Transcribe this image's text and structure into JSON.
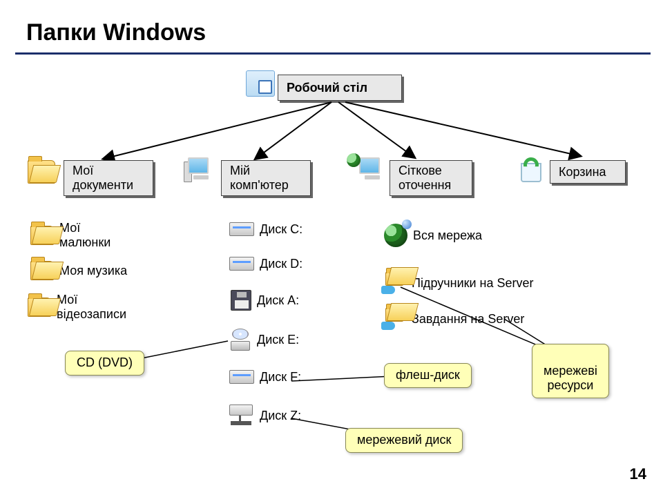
{
  "title": "Папки Windows",
  "root": {
    "label": "Робочий стіл"
  },
  "level1": {
    "docs": "Мої\nдокументи",
    "computer": "Мій\nкомп'ютер",
    "network": "Сіткове\nоточення",
    "recycle": "Корзина"
  },
  "mydocs": {
    "pictures": "Мої\nмалюнки",
    "music": "Моя музика",
    "videos": "Мої\nвідеозаписи"
  },
  "drives": {
    "c": "Диск C:",
    "d": "Диск D:",
    "a": "Диск A:",
    "e": "Диск E:",
    "f": "Диск F:",
    "z": "Диск Z:"
  },
  "network_items": {
    "whole": "Вся мережа",
    "textbooks": "Підручники на Server",
    "tasks": "Завдання на Server"
  },
  "callouts": {
    "cd": "CD (DVD)",
    "flash": "флеш-диск",
    "netres": "мережеві\nресурси",
    "netdrive": "мережевий диск"
  },
  "page_number": "14"
}
